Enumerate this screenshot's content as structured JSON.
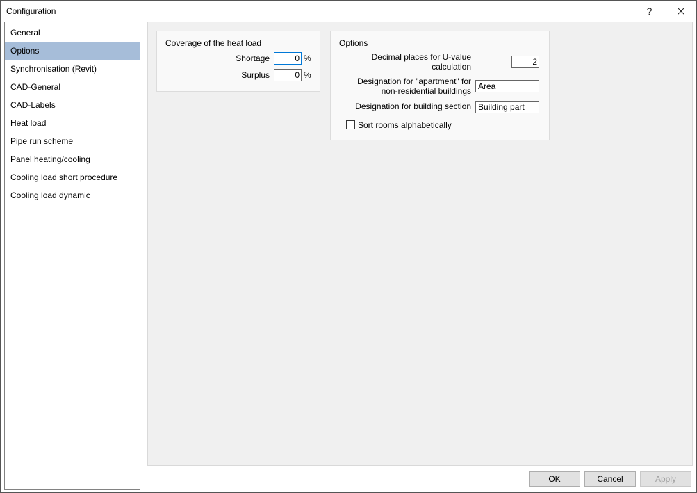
{
  "window": {
    "title": "Configuration"
  },
  "sidebar": {
    "items": [
      {
        "label": "General"
      },
      {
        "label": "Options"
      },
      {
        "label": "Synchronisation (Revit)"
      },
      {
        "label": "CAD-General"
      },
      {
        "label": "CAD-Labels"
      },
      {
        "label": "Heat load"
      },
      {
        "label": "Pipe run scheme"
      },
      {
        "label": "Panel heating/cooling"
      },
      {
        "label": "Cooling load short procedure"
      },
      {
        "label": "Cooling load dynamic"
      }
    ],
    "selected_index": 1
  },
  "coverage": {
    "legend": "Coverage of the heat load",
    "shortage_label": "Shortage",
    "shortage_value": "0",
    "surplus_label": "Surplus",
    "surplus_value": "0",
    "unit": "%"
  },
  "options": {
    "legend": "Options",
    "decimal_label": "Decimal places for U-value calculation",
    "decimal_value": "2",
    "apt_label": "Designation for \"apartment\" for non-residential buildings",
    "apt_value": "Area",
    "section_label": "Designation for building section",
    "section_value": "Building part",
    "sort_label": "Sort rooms alphabetically",
    "sort_checked": false
  },
  "footer": {
    "ok": "OK",
    "cancel": "Cancel",
    "apply": "Apply"
  }
}
